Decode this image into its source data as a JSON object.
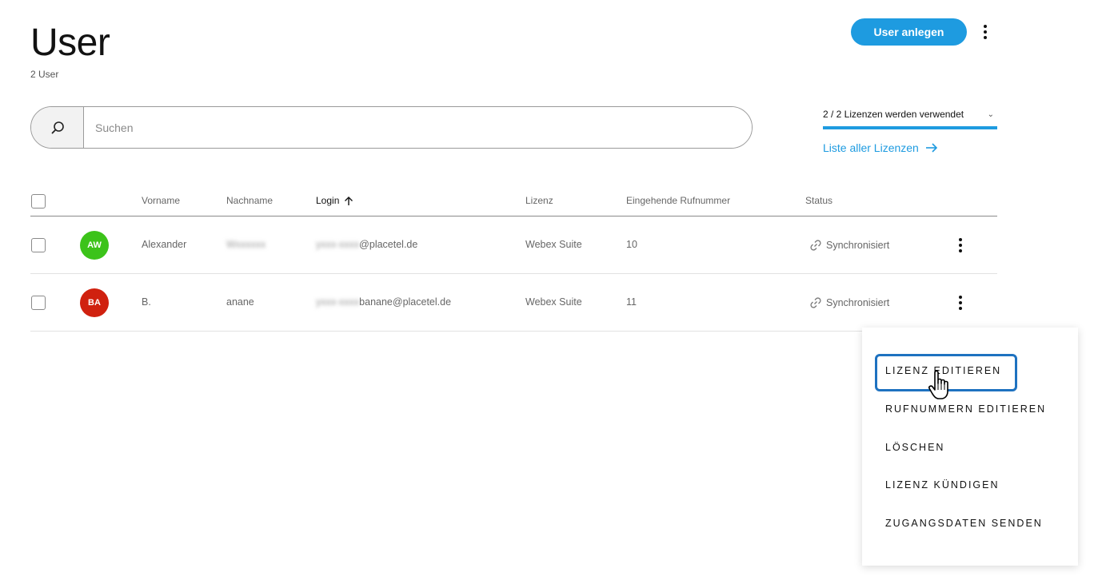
{
  "header": {
    "title": "User",
    "count": "2 User",
    "add_button": "User anlegen"
  },
  "search": {
    "placeholder": "Suchen"
  },
  "licenses": {
    "selector": "2 / 2 Lizenzen werden verwendet",
    "link": "Liste aller Lizenzen",
    "used_fraction": 1.0
  },
  "table": {
    "columns": {
      "vorname": "Vorname",
      "nachname": "Nachname",
      "login": "Login",
      "lizenz": "Lizenz",
      "rufnummer": "Eingehende Rufnummer",
      "status": "Status"
    },
    "rows": [
      {
        "initials": "AW",
        "avatar_color": "#3cc31a",
        "vorname": "Alexander",
        "nachname": "Wxxxxxx",
        "login_hidden": "yxxx-xxxx",
        "login_visible": "@placetel.de",
        "lizenz": "Webex Suite",
        "rufnummer": "10",
        "status": "Synchronisiert"
      },
      {
        "initials": "BA",
        "avatar_color": "#d0210f",
        "vorname": "B.",
        "nachname": "anane",
        "login_hidden": "yxxx-xxxx",
        "login_visible": "banane@placetel.de",
        "lizenz": "Webex Suite",
        "rufnummer": "11",
        "status": "Synchronisiert"
      }
    ]
  },
  "context_menu": {
    "items": [
      "LIZENZ EDITIEREN",
      "RUFNUMMERN EDITIEREN",
      "LÖSCHEN",
      "LIZENZ KÜNDIGEN",
      "ZUGANGSDATEN SENDEN"
    ]
  },
  "colors": {
    "accent": "#1e9be0",
    "focus": "#1e72c0"
  }
}
